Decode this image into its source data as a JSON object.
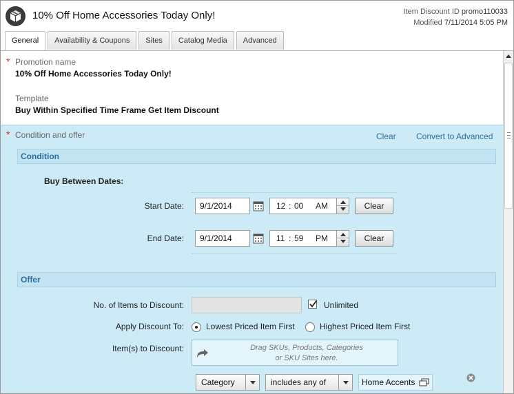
{
  "header": {
    "title": "10% Off Home Accessories Today Only!",
    "id_label": "Item Discount ID",
    "id_value": "promo110033",
    "modified_label": "Modified",
    "modified_value": "7/11/2014 5:05 PM",
    "icon": "box-icon"
  },
  "tabs": [
    {
      "label": "General",
      "active": true
    },
    {
      "label": "Availability & Coupons",
      "active": false
    },
    {
      "label": "Sites",
      "active": false
    },
    {
      "label": "Catalog Media",
      "active": false
    },
    {
      "label": "Advanced",
      "active": false
    }
  ],
  "general": {
    "required_mark": "*",
    "promotion_name_label": "Promotion name",
    "promotion_name_value": "10% Off Home Accessories Today Only!",
    "template_label": "Template",
    "template_value": "Buy Within Specified Time Frame Get Item Discount"
  },
  "condition_offer": {
    "required_mark": "*",
    "label": "Condition and offer",
    "clear_link": "Clear",
    "convert_link": "Convert to Advanced",
    "condition_header": "Condition",
    "buy_between_label": "Buy Between Dates:",
    "start_date_label": "Start Date:",
    "start_date_value": "9/1/2014",
    "start_hour": "12",
    "start_sep": ":",
    "start_min": "00",
    "start_ampm": "AM",
    "end_date_label": "End Date:",
    "end_date_value": "9/1/2014",
    "end_hour": "11",
    "end_sep": ":",
    "end_min": "59",
    "end_ampm": "PM",
    "clear_button": "Clear",
    "offer_header": "Offer",
    "items_to_discount_label": "No. of Items to Discount:",
    "items_to_discount_value": "",
    "unlimited_label": "Unlimited",
    "unlimited_checked": true,
    "apply_discount_label": "Apply Discount To:",
    "apply_options": [
      "Lowest Priced Item First",
      "Highest Priced Item First"
    ],
    "apply_selected": "Lowest Priced Item First",
    "items_label": "Item(s) to Discount:",
    "drop_hint_line1": "Drag SKUs, Products, Categories",
    "drop_hint_line2": "or SKU Sites here.",
    "filter_type": "Category",
    "filter_op": "includes any of",
    "filter_value": "Home Accents"
  },
  "colors": {
    "accent_link": "#2e6f9e",
    "panel_bg": "#ccebf7",
    "required": "#d92b2b"
  }
}
